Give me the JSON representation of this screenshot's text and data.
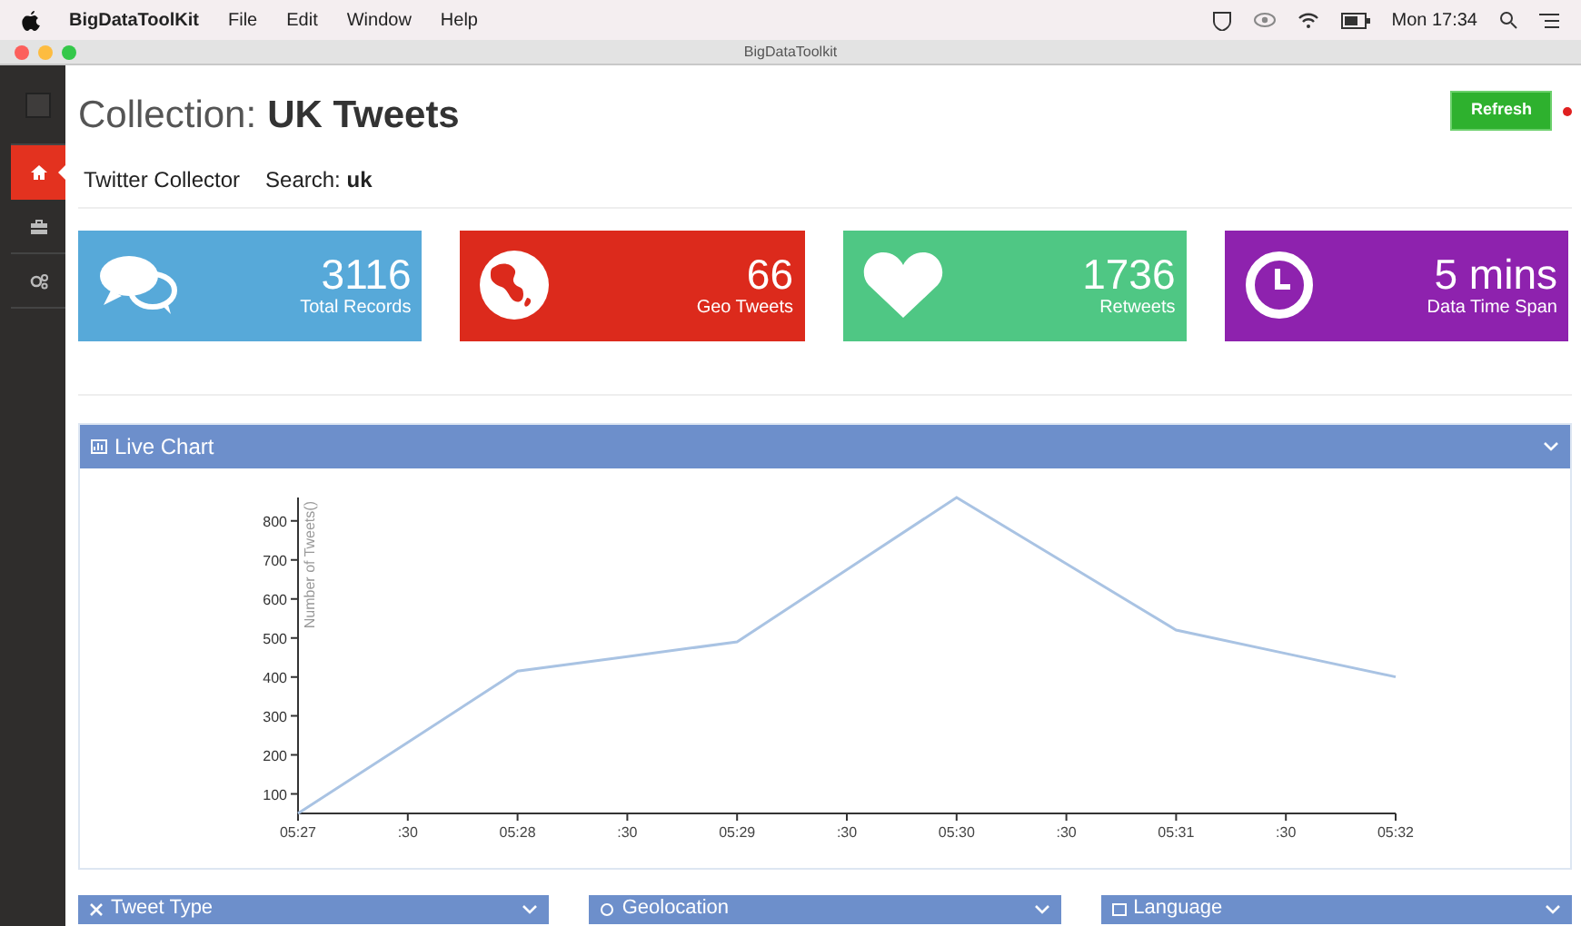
{
  "menu_bar": {
    "app_name": "BigDataToolKit",
    "menus": [
      "File",
      "Edit",
      "Window",
      "Help"
    ],
    "clock": "Mon 17:34"
  },
  "window": {
    "title": "BigDataToolkit"
  },
  "sidebar": {
    "items": [
      {
        "kind": "home",
        "selected": true
      },
      {
        "kind": "briefcase",
        "selected": false
      },
      {
        "kind": "gears",
        "selected": false
      }
    ]
  },
  "header": {
    "title_prefix": "Collection:",
    "title": "UK Tweets",
    "collector": "Twitter Collector",
    "search": "Search: **uk**",
    "refresh_button": "Refresh"
  },
  "stats": [
    {
      "kind": "chat",
      "value": "3116",
      "label": "Total Records",
      "color": "#57a9d9"
    },
    {
      "kind": "globe",
      "value": "66",
      "label": "Geo Tweets",
      "color": "#dc2a1c"
    },
    {
      "kind": "heart",
      "value": "1736",
      "label": "Retweets",
      "color": "#4fc784"
    },
    {
      "kind": "clock",
      "value": "5 mins",
      "label": "Data Time Span",
      "color": "#8e22ae"
    }
  ],
  "live_chart": {
    "title": "Live Chart",
    "chart_data": {
      "type": "line",
      "ylabel": "Number of Tweets()",
      "categories": [
        "05:27",
        ":30",
        "05:28",
        ":30",
        "05:29",
        ":30",
        "05:30",
        ":30",
        "05:31",
        ":30",
        "05:32"
      ],
      "series": [
        {
          "color": "#a9c3e3",
          "values": [
            50,
            232,
            415,
            452,
            490,
            675,
            860,
            690,
            520,
            460,
            400
          ]
        }
      ],
      "ylim": [
        50,
        860
      ],
      "yticks": [
        100,
        200,
        300,
        400,
        500,
        600,
        700,
        800
      ]
    }
  },
  "bottom_panels": [
    {
      "kind": "tweet_type",
      "title": "Tweet Type"
    },
    {
      "kind": "geolocation",
      "title": "Geolocation"
    },
    {
      "kind": "language",
      "title": "Language"
    }
  ]
}
